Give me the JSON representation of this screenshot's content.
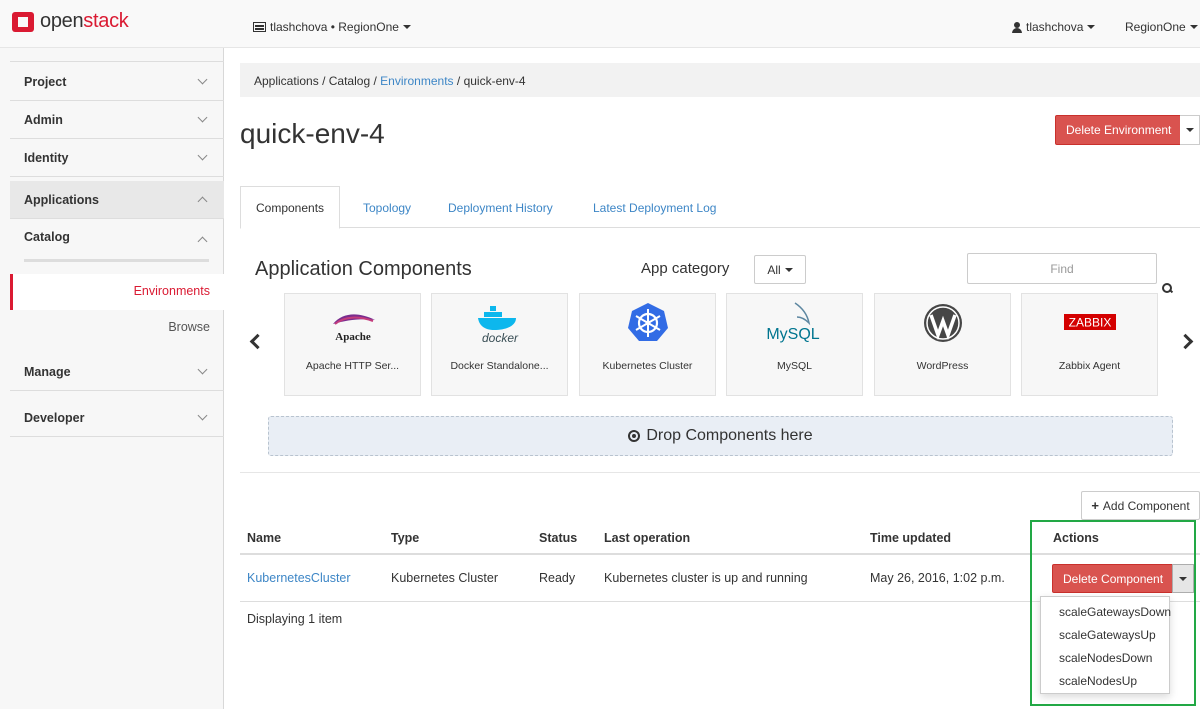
{
  "brand": {
    "prefix": "open",
    "suffix": "stack",
    "accent": "#da1a32"
  },
  "topbar": {
    "project_selector": "tlashchova • RegionOne",
    "user": "tlashchova",
    "region": "RegionOne"
  },
  "sidebar": {
    "items": [
      {
        "label": "Project"
      },
      {
        "label": "Admin"
      },
      {
        "label": "Identity"
      },
      {
        "label": "Applications"
      },
      {
        "label": "Catalog"
      },
      {
        "label": "Environments"
      },
      {
        "label": "Browse"
      },
      {
        "label": "Manage"
      },
      {
        "label": "Developer"
      }
    ]
  },
  "breadcrumb": {
    "items": [
      "Applications",
      "Catalog",
      "Environments",
      "quick-env-4"
    ],
    "separator": "/"
  },
  "page": {
    "title": "quick-env-4",
    "delete_env_label": "Delete Environment"
  },
  "tabs": [
    {
      "label": "Components",
      "active": true
    },
    {
      "label": "Topology"
    },
    {
      "label": "Deployment History"
    },
    {
      "label": "Latest Deployment Log"
    }
  ],
  "components_section": {
    "title": "Application Components",
    "category_label": "App category",
    "category_value": "All",
    "find_placeholder": "Find"
  },
  "apps": [
    {
      "name": "Apache HTTP Ser...",
      "logo_text": "Apache",
      "icon": "apache-feather-icon"
    },
    {
      "name": "Docker Standalone...",
      "logo_text": "docker",
      "icon": "docker-whale-icon"
    },
    {
      "name": "Kubernetes Cluster",
      "icon": "kubernetes-helm-icon"
    },
    {
      "name": "MySQL",
      "logo_text": "MySQL",
      "icon": "mysql-dolphin-icon"
    },
    {
      "name": "WordPress",
      "icon": "wordpress-icon"
    },
    {
      "name": "Zabbix Agent",
      "logo_text": "ZABBIX",
      "icon": "zabbix-icon"
    }
  ],
  "drop_zone": {
    "label": "Drop Components here"
  },
  "add_component_label": "Add Component",
  "table": {
    "headers": [
      "Name",
      "Type",
      "Status",
      "Last operation",
      "Time updated",
      "Actions"
    ],
    "rows": [
      {
        "name": "KubernetesCluster",
        "type": "Kubernetes Cluster",
        "status": "Ready",
        "last_operation": "Kubernetes cluster is up and running",
        "time_updated": "May 26, 2016, 1:02 p.m.",
        "action_label": "Delete Component"
      }
    ],
    "footer": "Displaying 1 item"
  },
  "action_menu": [
    "scaleGatewaysDown",
    "scaleGatewaysUp",
    "scaleNodesDown",
    "scaleNodesUp"
  ],
  "colors": {
    "link": "#3d86c6",
    "danger": "#d9534f",
    "highlight": "#22a845"
  }
}
